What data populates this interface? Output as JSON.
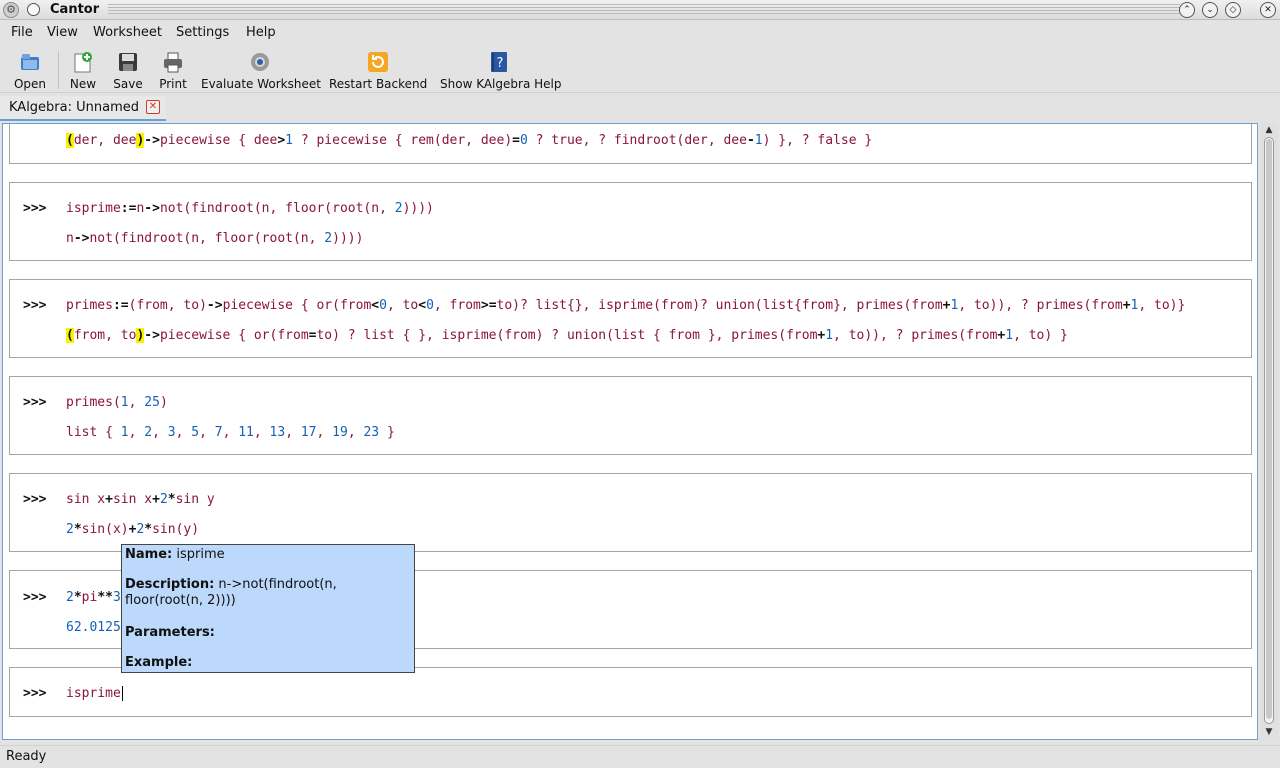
{
  "window": {
    "title": "Cantor"
  },
  "menu": {
    "file": "File",
    "view": "View",
    "worksheet": "Worksheet",
    "settings": "Settings",
    "help": "Help"
  },
  "toolbar": {
    "open": "Open",
    "new": "New",
    "save": "Save",
    "print": "Print",
    "evaluate": "Evaluate Worksheet",
    "restart": "Restart Backend",
    "help": "Show KAlgebra Help"
  },
  "tab": {
    "title": "KAlgebra: Unnamed"
  },
  "entries": [
    {
      "prompt": "",
      "code": "",
      "result": "(der, dee)->piecewise { dee>1 ? piecewise { rem(der, dee)=0 ? true, ? findroot(der, dee-1) }, ? false }"
    },
    {
      "prompt": ">>>",
      "code": "isprime:=n->not(findroot(n, floor(root(n, 2))))",
      "result": "n->not(findroot(n, floor(root(n, 2))))"
    },
    {
      "prompt": ">>>",
      "code": "primes:=(from, to)->piecewise { or(from<0, to<0, from>=to)? list{}, isprime(from)? union(list{from}, primes(from+1, to)), ? primes(from+1, to)}",
      "result": "(from, to)->piecewise { or(from=to) ? list { }, isprime(from) ? union(list { from }, primes(from+1, to)), ? primes(from+1, to) }"
    },
    {
      "prompt": ">>>",
      "code": "primes(1, 25)",
      "result": "list { 1, 2, 3, 5, 7, 11, 13, 17, 19, 23 }"
    },
    {
      "prompt": ">>>",
      "code": "sin x+sin x+2*sin y",
      "result": "2*sin(x)+2*sin(y)"
    },
    {
      "prompt": ">>>",
      "code": "2*pi**3",
      "result": "62.0125"
    },
    {
      "prompt": ">>>",
      "code": "isprime",
      "result": ""
    }
  ],
  "tooltip": {
    "name_label": "Name:",
    "name_value": "isprime",
    "desc_label": "Description:",
    "desc_value": "n->not(findroot(n, floor(root(n, 2))))",
    "params_label": "Parameters:",
    "example_label": "Example:"
  },
  "status": {
    "text": "Ready"
  },
  "colors": {
    "code": "#8a1538",
    "number": "#1460b4",
    "tooltip_bg": "#bcd8fb",
    "accent": "#6b9fd8",
    "highlight": "#f6f200"
  }
}
